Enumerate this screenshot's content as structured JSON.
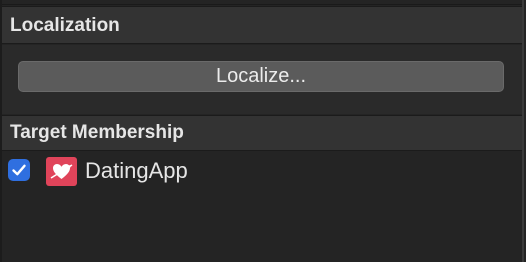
{
  "localization": {
    "header": "Localization",
    "button_label": "Localize..."
  },
  "target_membership": {
    "header": "Target Membership",
    "targets": [
      {
        "name": "DatingApp",
        "checked": true,
        "icon": "heart-arrow-icon"
      }
    ]
  },
  "colors": {
    "background": "#242424",
    "section_header": "#333333",
    "button": "#5b5b5b",
    "checkbox_accent": "#2f6fe0",
    "app_icon": "#e0445a"
  }
}
